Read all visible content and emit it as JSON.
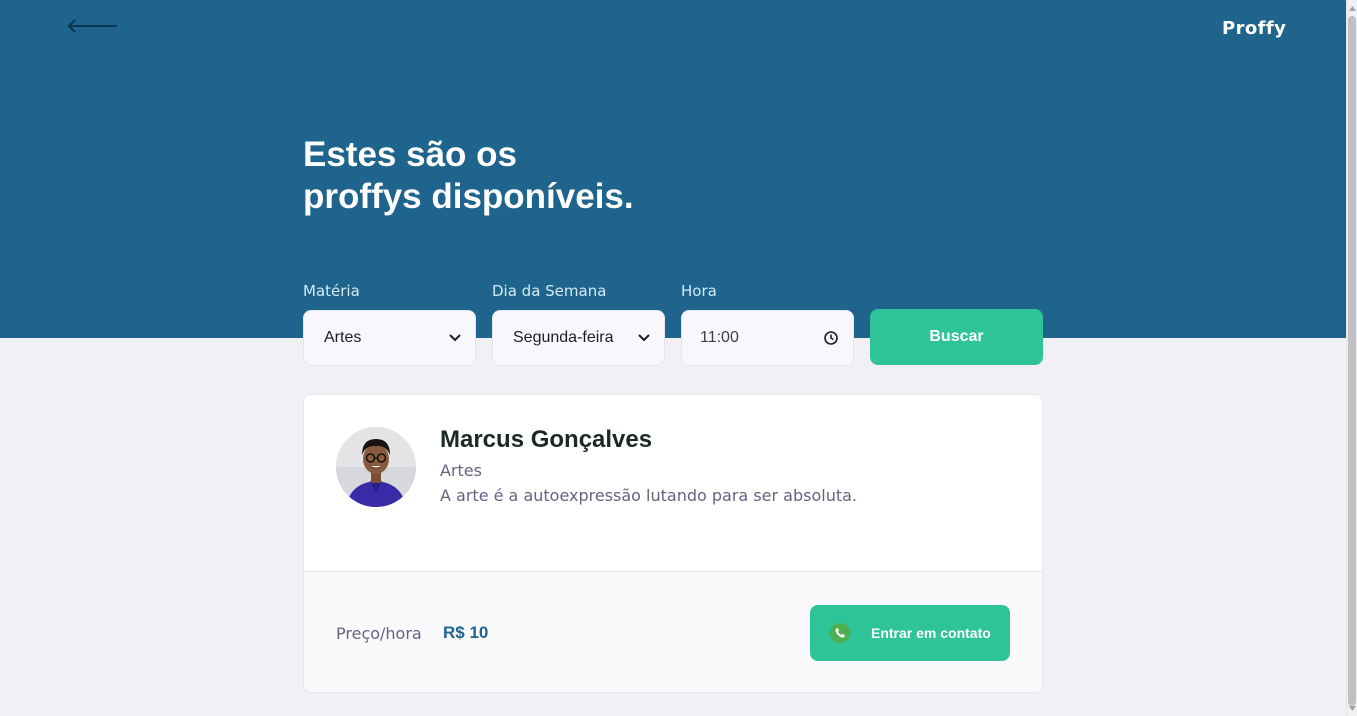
{
  "header": {
    "brand": "Proffy",
    "title_line1": "Estes são os",
    "title_line2": "proffys disponíveis.",
    "back_icon": "arrow-left-icon",
    "background": "#1e648c"
  },
  "filters": {
    "subject": {
      "label": "Matéria",
      "value": "Artes"
    },
    "weekday": {
      "label": "Dia da Semana",
      "value": "Segunda-feira"
    },
    "time": {
      "label": "Hora",
      "value": "11:00"
    },
    "search_label": "Buscar"
  },
  "teacher": {
    "name": "Marcus Gonçalves",
    "subject": "Artes",
    "bio": "A arte é a autoexpressão lutando para ser absoluta.",
    "price_label": "Preço/hora",
    "price_value": "R$ 10",
    "contact_label": "Entrar em contato",
    "contact_icon": "whatsapp-icon"
  },
  "colors": {
    "primary": "#1e648c",
    "accent": "#2ec498",
    "background": "#f0f0f5"
  }
}
